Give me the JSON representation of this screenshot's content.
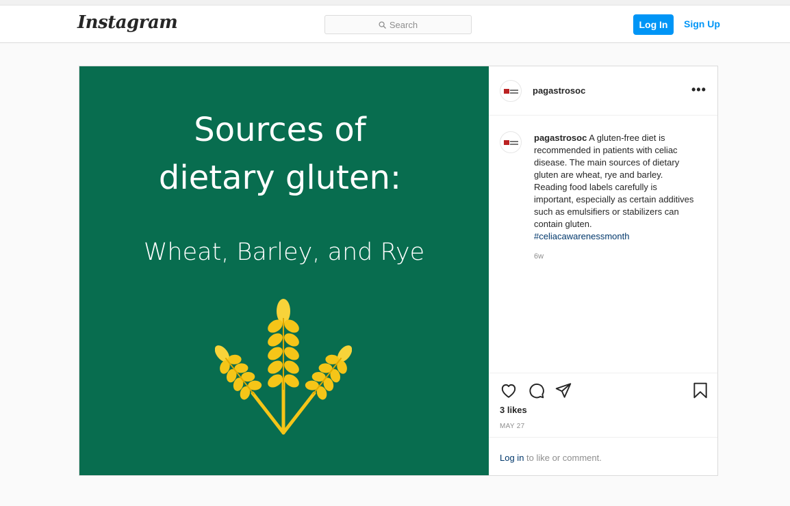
{
  "header": {
    "logo_text": "Instagram",
    "search_placeholder": "Search",
    "login_label": "Log In",
    "signup_label": "Sign Up"
  },
  "post": {
    "image": {
      "title_line1": "Sources of",
      "title_line2": "dietary gluten:",
      "subtitle": "Wheat, Barley, and Rye",
      "background_color": "#086d4f",
      "illustration": "wheat-stalks-icon"
    },
    "author": {
      "username": "pagastrosoc"
    },
    "caption": {
      "username": "pagastrosoc",
      "text": "A gluten-free diet is recommended in patients with celiac disease. The main sources of dietary gluten are wheat, rye and barley. Reading food labels carefully is important, especially as certain additives such as emulsifiers or stabilizers can contain gluten.",
      "hashtag": "#celiacawarenessmonth",
      "age": "6w"
    },
    "likes": "3 likes",
    "date": "MAY 27",
    "login_prompt": {
      "link": "Log in",
      "text": "to like or comment."
    }
  },
  "colors": {
    "accent": "#0095f6",
    "link": "#00376b",
    "muted": "#8e8e8e",
    "wheat": "#f5c518"
  }
}
